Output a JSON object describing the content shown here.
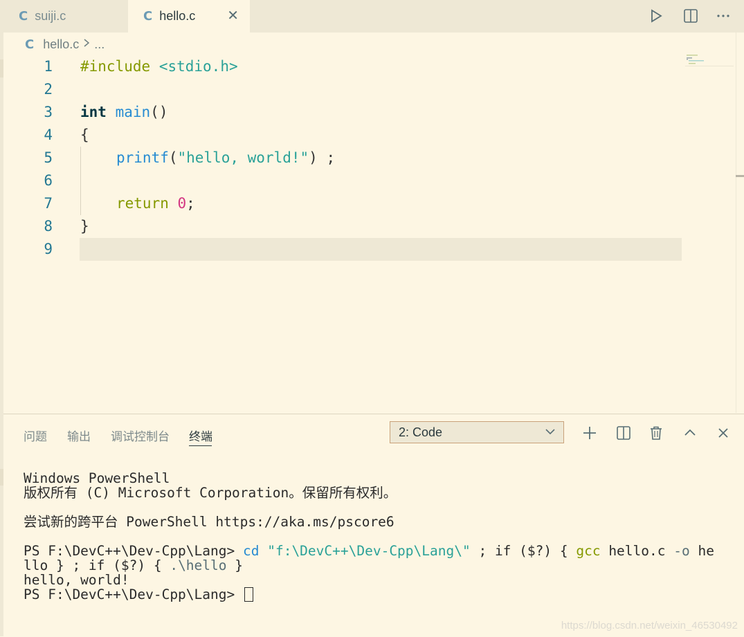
{
  "tabs": [
    {
      "icon": "C",
      "label": "suiji.c"
    },
    {
      "icon": "C",
      "label": "hello.c",
      "close": "✕"
    }
  ],
  "breadcrumb": {
    "icon": "C",
    "file": "hello.c",
    "more": "..."
  },
  "editor": {
    "line_numbers": [
      "1",
      "2",
      "3",
      "4",
      "5",
      "6",
      "7",
      "8",
      "9"
    ],
    "lines": {
      "l1": {
        "directive": "#include",
        "header": "<stdio.h>"
      },
      "l3": {
        "type": "int",
        "fn": "main",
        "parens": "()"
      },
      "l4": {
        "brace": "{"
      },
      "l5": {
        "fn": "printf",
        "open": "(",
        "str": "\"hello, world!\"",
        "close": ") ;"
      },
      "l7": {
        "kw": "return",
        "num": "0",
        "semi": ";"
      },
      "l8": {
        "brace": "}"
      }
    }
  },
  "panel": {
    "tabs": [
      "问题",
      "输出",
      "调试控制台",
      "终端"
    ],
    "active_tab": "终端",
    "terminal_select": "2: Code"
  },
  "terminal": {
    "line1": "Windows PowerShell",
    "line2": "版权所有 (C) Microsoft Corporation。保留所有权利。",
    "line3": "尝试新的跨平台 PowerShell https://aka.ms/pscore6",
    "prompt1": "PS F:\\DevC++\\Dev-Cpp\\Lang> ",
    "cmd_cd": "cd",
    "cmd_path": "\"f:\\DevC++\\Dev-Cpp\\Lang\\\"",
    "cmd_rest1": " ; if ($?) { ",
    "cmd_gcc": "gcc",
    "cmd_file": " hello.c ",
    "cmd_o": "-o",
    "cmd_he": " he",
    "cmd_line2a": "llo } ; if ($?) { ",
    "cmd_line2b": ".\\hello",
    "cmd_line2c": " }",
    "output": "hello, world!",
    "prompt2": "PS F:\\DevC++\\Dev-Cpp\\Lang> "
  },
  "watermark": "https://blog.csdn.net/weixin_46530492",
  "colors": {
    "background": "#fdf6e3",
    "tabbar": "#eee8d5",
    "keyword": "#859900",
    "string": "#2aa198",
    "function": "#268bd2",
    "number": "#d33682"
  }
}
